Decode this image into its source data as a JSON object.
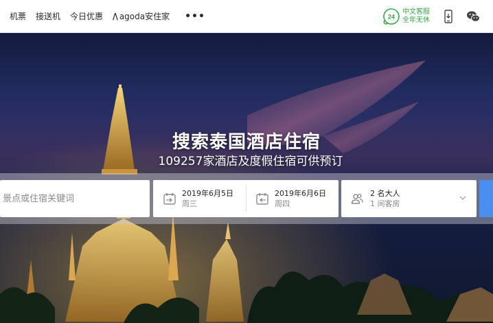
{
  "nav": {
    "items": [
      "机票",
      "接送机",
      "今日优惠"
    ],
    "agoda_mark": "/∕",
    "agoda_label": "agoda安住家",
    "more": "•••"
  },
  "support": {
    "badge": "24",
    "line1": "中文客服",
    "line2": "全年无休"
  },
  "hero": {
    "title": "搜索泰国酒店住宿",
    "subtitle": "109257家酒店及度假住宿可供预订"
  },
  "search": {
    "placeholder": "景点或住宿关键词",
    "checkin": {
      "date": "2019年6月5日",
      "weekday": "周三"
    },
    "checkout": {
      "date": "2019年6月6日",
      "weekday": "周四"
    },
    "guests": {
      "main": "2 名大人",
      "sub": "1 间客房"
    }
  },
  "colors": {
    "accent_green": "#3aa54a",
    "search_blue": "#4a8ff0"
  }
}
